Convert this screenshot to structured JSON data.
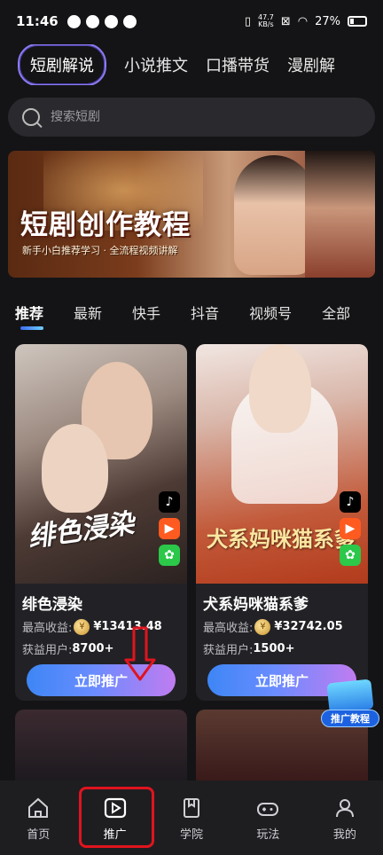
{
  "status_bar": {
    "time": "11:46",
    "net_speed_value": "47.7",
    "net_speed_unit": "KB/s",
    "battery": "27%"
  },
  "category_tabs": [
    "短剧解说",
    "小说推文",
    "口播带货",
    "漫剧解"
  ],
  "search": {
    "placeholder": "搜索短剧"
  },
  "banner": {
    "title": "短剧创作教程",
    "subtitle": "新手小白推荐学习 · 全流程视频讲解"
  },
  "platform_tabs": [
    "推荐",
    "最新",
    "快手",
    "抖音",
    "视频号",
    "全部"
  ],
  "cards": [
    {
      "name": "绯色浸染",
      "poster_title": "绯色浸染",
      "earnings_label": "最高收益:",
      "earnings_value": "¥13413.48",
      "users_label": "获益用户:",
      "users_value": "8700+",
      "button": "立即推广"
    },
    {
      "name": "犬系妈咪猫系爹",
      "poster_title": "犬系妈咪猫系爹",
      "earnings_label": "最高收益:",
      "earnings_value": "¥32742.05",
      "users_label": "获益用户:",
      "users_value": "1500+",
      "button": "立即推广"
    }
  ],
  "promo_badge": "推广教程",
  "bottom_nav": [
    "首页",
    "推广",
    "学院",
    "玩法",
    "我的"
  ],
  "colors": {
    "accent": "#8b7bf0",
    "button_gradient_start": "#3e86f5",
    "button_gradient_end": "#c07cf0",
    "highlight": "#e0141e"
  }
}
